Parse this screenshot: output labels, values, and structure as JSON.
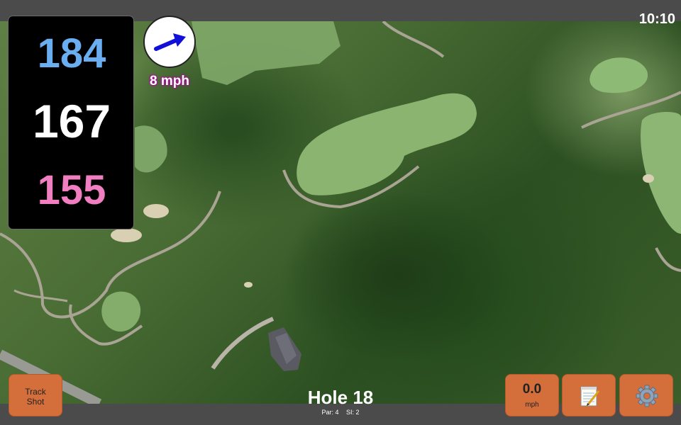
{
  "status": {
    "time": "10:10"
  },
  "yardages": {
    "back": "184",
    "center": "167",
    "front": "155"
  },
  "wind": {
    "speed_label": "8 mph",
    "direction_icon": "arrow-icon"
  },
  "buttons": {
    "track_shot": [
      "Track",
      "Shot"
    ],
    "speed_value": "0.0",
    "speed_unit": "mph",
    "notes_icon": "notepad-icon",
    "settings_icon": "gear-icon"
  },
  "hole": {
    "title": "Hole 18",
    "par": "Par: 4",
    "si": "SI: 2"
  },
  "colors": {
    "back": "#6aaef2",
    "center": "#ffffff",
    "front": "#f07ec0",
    "button": "#d46f3c",
    "wind_arrow": "#1010d8"
  }
}
